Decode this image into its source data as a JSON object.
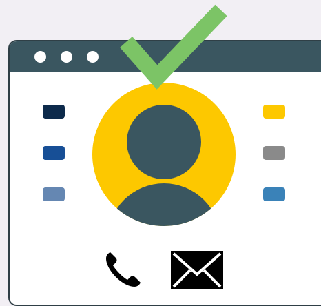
{
  "colors": {
    "background": "#f2eff4",
    "window_bar": "#3a5660",
    "window_border": "#2f3f46",
    "window_body": "#ffffff",
    "avatar_bg": "#fdc800",
    "avatar_figure": "#3a5660",
    "check": "#7cc466",
    "icon": "#000000"
  },
  "window": {
    "controls": [
      "dot-1",
      "dot-2",
      "dot-3"
    ]
  },
  "swatches": {
    "left": [
      "#0d2a4b",
      "#174f96",
      "#6587b2"
    ],
    "right": [
      "#fdc800",
      "#8a8a8a",
      "#3a82b8"
    ]
  },
  "icons": {
    "check": "checkmark-icon",
    "avatar": "user-avatar-icon",
    "phone": "phone-icon",
    "email": "envelope-icon"
  }
}
